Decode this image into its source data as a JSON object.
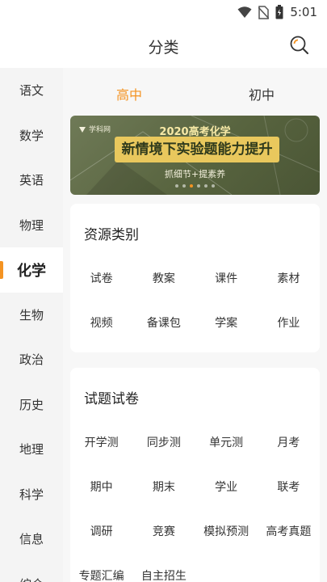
{
  "status_bar": {
    "time": "5:01",
    "icons": [
      "wifi-icon",
      "no-sim-icon",
      "battery-icon"
    ]
  },
  "header": {
    "title": "分类",
    "search_icon": "search-icon"
  },
  "sidebar": {
    "items": [
      {
        "label": "语文"
      },
      {
        "label": "数学"
      },
      {
        "label": "英语"
      },
      {
        "label": "物理"
      },
      {
        "label": "化学"
      },
      {
        "label": "生物"
      },
      {
        "label": "政治"
      },
      {
        "label": "历史"
      },
      {
        "label": "地理"
      },
      {
        "label": "科学"
      },
      {
        "label": "信息"
      },
      {
        "label": "综合"
      }
    ],
    "active_index": 4
  },
  "level_tabs": [
    {
      "label": "高中"
    },
    {
      "label": "初中"
    }
  ],
  "banner": {
    "logo": "学科网",
    "year_line": "2020高考化学",
    "headline": "新情境下实验题能力提升",
    "sub": "抓细节+提素养",
    "slide_count": 6,
    "active_slide": 2
  },
  "resource_card": {
    "title": "资源类别",
    "items": [
      {
        "label": "试卷"
      },
      {
        "label": "教案"
      },
      {
        "label": "课件"
      },
      {
        "label": "素材"
      },
      {
        "label": "视频"
      },
      {
        "label": "备课包"
      },
      {
        "label": "学案"
      },
      {
        "label": "作业"
      }
    ]
  },
  "paper_card": {
    "title": "试题试卷",
    "items": [
      {
        "label": "开学测"
      },
      {
        "label": "同步测"
      },
      {
        "label": "单元测"
      },
      {
        "label": "月考"
      },
      {
        "label": "期中"
      },
      {
        "label": "期末"
      },
      {
        "label": "学业"
      },
      {
        "label": "联考"
      },
      {
        "label": "调研"
      },
      {
        "label": "竞赛"
      },
      {
        "label": "模拟预测"
      },
      {
        "label": "高考真题"
      },
      {
        "label": "专题汇编"
      },
      {
        "label": "自主招生"
      }
    ]
  },
  "colors": {
    "accent": "#f49322",
    "sidebar_bg": "#f4f4f4",
    "main_bg": "#f7f7f7",
    "banner_green": "#58643f",
    "banner_gold": "#e9c85d"
  }
}
